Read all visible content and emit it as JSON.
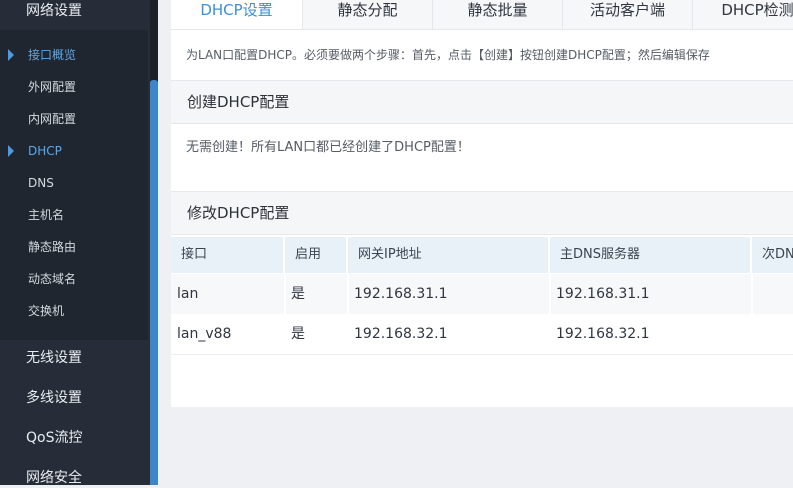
{
  "sidebar": {
    "top_group": "网络设置",
    "items": [
      {
        "label": "接口概览",
        "active": true
      },
      {
        "label": "外网配置",
        "active": false
      },
      {
        "label": "内网配置",
        "active": false
      },
      {
        "label": "DHCP",
        "active": true
      },
      {
        "label": "DNS",
        "active": false
      },
      {
        "label": "主机名",
        "active": false
      },
      {
        "label": "静态路由",
        "active": false
      },
      {
        "label": "动态域名",
        "active": false
      },
      {
        "label": "交换机",
        "active": false
      }
    ],
    "groups": [
      "无线设置",
      "多线设置",
      "QoS流控",
      "网络安全"
    ]
  },
  "tabs": [
    "DHCP设置",
    "静态分配",
    "静态批量",
    "活动客户端",
    "DHCP检测"
  ],
  "active_tab": "DHCP设置",
  "description": "为LAN口配置DHCP。必须要做两个步骤：首先，点击【创建】按钮创建DHCP配置；然后编辑保存",
  "create_section": {
    "title": "创建DHCP配置",
    "note": "无需创建！所有LAN口都已经创建了DHCP配置！"
  },
  "modify_section": {
    "title": "修改DHCP配置",
    "columns": [
      "接口",
      "启用",
      "网关IP地址",
      "主DNS服务器",
      "次DN"
    ],
    "rows": [
      {
        "iface": "lan",
        "enabled": "是",
        "gateway": "192.168.31.1",
        "dns1": "192.168.31.1"
      },
      {
        "iface": "lan_v88",
        "enabled": "是",
        "gateway": "192.168.32.1",
        "dns1": "192.168.32.1"
      }
    ]
  },
  "colors": {
    "sidebar_bg": "#262d38",
    "accent": "#3d8fd6",
    "active_item": "#5aa9ee",
    "table_header_bg": "#e9f1f8"
  }
}
